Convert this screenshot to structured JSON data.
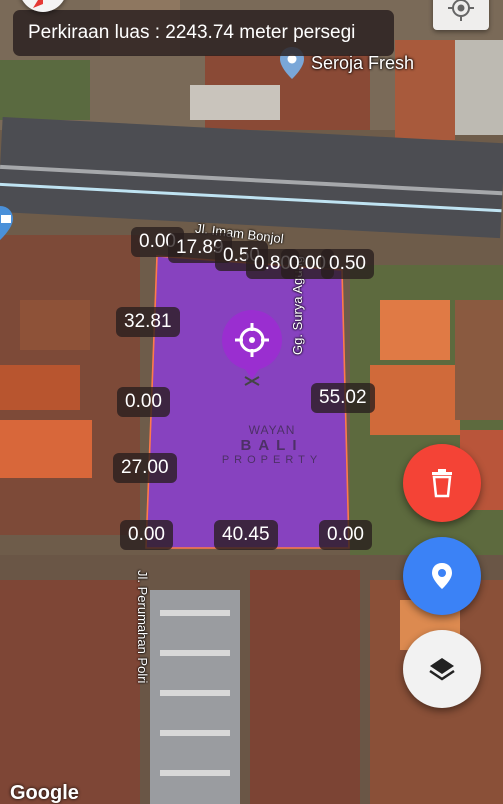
{
  "area_banner": {
    "text": "Perkiraan luas : 2243.74 meter persegi"
  },
  "poi": {
    "name": "Seroja Fresh"
  },
  "streets": {
    "north": "Jl. Imam Bonjol",
    "east": "Gg. Surya Agung",
    "south": "Jl. Perumahan Polri"
  },
  "watermark": {
    "line1": "WAYAN",
    "line2": "BALI",
    "line3": "PROPERTY"
  },
  "dimension_labels": [
    {
      "value": "0.00"
    },
    {
      "value": "17.89"
    },
    {
      "value": "0.50"
    },
    {
      "value": "0.80"
    },
    {
      "value": "0.00"
    },
    {
      "value": "0.50"
    },
    {
      "value": "32.81"
    },
    {
      "value": "0.00"
    },
    {
      "value": "55.02"
    },
    {
      "value": "27.00"
    },
    {
      "value": "0.00"
    },
    {
      "value": "40.45"
    },
    {
      "value": "0.00"
    }
  ],
  "buttons": {
    "delete": {
      "icon": "trash-icon",
      "color": "#f44336"
    },
    "location": {
      "icon": "map-pin-icon",
      "color": "#3b82f6"
    },
    "layers": {
      "icon": "layers-icon",
      "color": "#f2f2f2"
    },
    "my_location": {
      "icon": "crosshair-icon"
    },
    "compass": {
      "icon": "compass-icon"
    }
  },
  "colors": {
    "polygon_fill": "#8b3fcf",
    "polygon_stroke": "#ff7a4a"
  },
  "attribution": {
    "text": "Google"
  }
}
